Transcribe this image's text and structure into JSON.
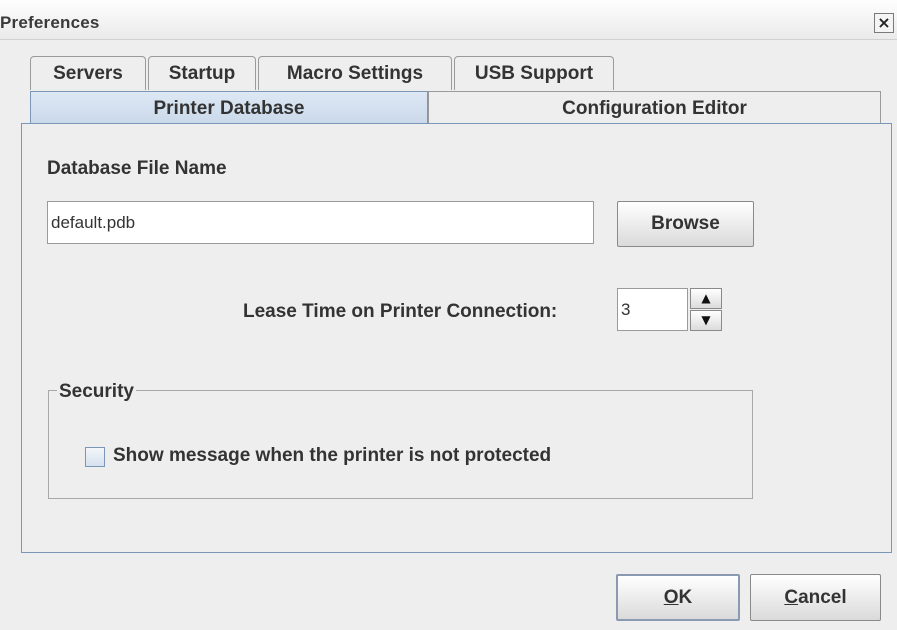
{
  "window": {
    "title": "Preferences",
    "close_symbol": "×"
  },
  "tabs": {
    "row1": [
      "Servers",
      "Startup",
      "Macro Settings",
      "USB Support"
    ],
    "row2": [
      "Printer Database",
      "Configuration Editor"
    ],
    "selected": "Printer Database"
  },
  "database": {
    "label": "Database File Name",
    "file_value": "default.pdb",
    "browse_label": "Browse"
  },
  "lease": {
    "label": "Lease Time on Printer Connection:",
    "value": "3",
    "up_symbol": "▲",
    "down_symbol": "▼"
  },
  "security": {
    "group_title": "Security",
    "checkbox_label": "Show message when the printer is not protected",
    "checkbox_checked": false
  },
  "footer": {
    "ok_mnemonic": "O",
    "ok_rest": "K",
    "cancel_mnemonic": "C",
    "cancel_rest": "ancel"
  },
  "colors": {
    "selected_tab": "#c9d8ea",
    "panel_border": "#7b97b8",
    "background": "#eeeeee"
  }
}
